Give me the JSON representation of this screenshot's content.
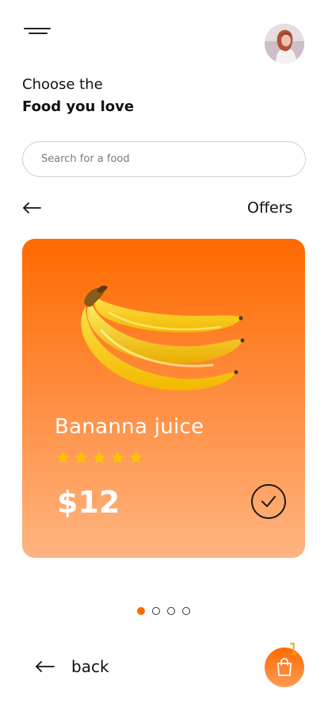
{
  "header": {
    "menu_icon": "menu-icon",
    "avatar_icon": "profile-avatar"
  },
  "headline": {
    "line1": "Choose the",
    "line2": "Food you love"
  },
  "search": {
    "placeholder": "Search for a food",
    "value": ""
  },
  "section": {
    "back_icon": "arrow-left-icon",
    "title": "Offers"
  },
  "card": {
    "product_name": "Bananna juice",
    "rating": 5,
    "rating_max": 5,
    "price": "$12",
    "image": "banana-image",
    "action_icon": "checkmark-icon"
  },
  "pagination": {
    "count": 4,
    "active_index": 0
  },
  "footer": {
    "back_label": "back",
    "cart_icon": "shopping-bag-icon",
    "cart_count": "1"
  },
  "colors": {
    "accent": "#ff6a00",
    "accent_light": "#ffb480",
    "star": "#ffc400",
    "badge": "#f5a300"
  }
}
